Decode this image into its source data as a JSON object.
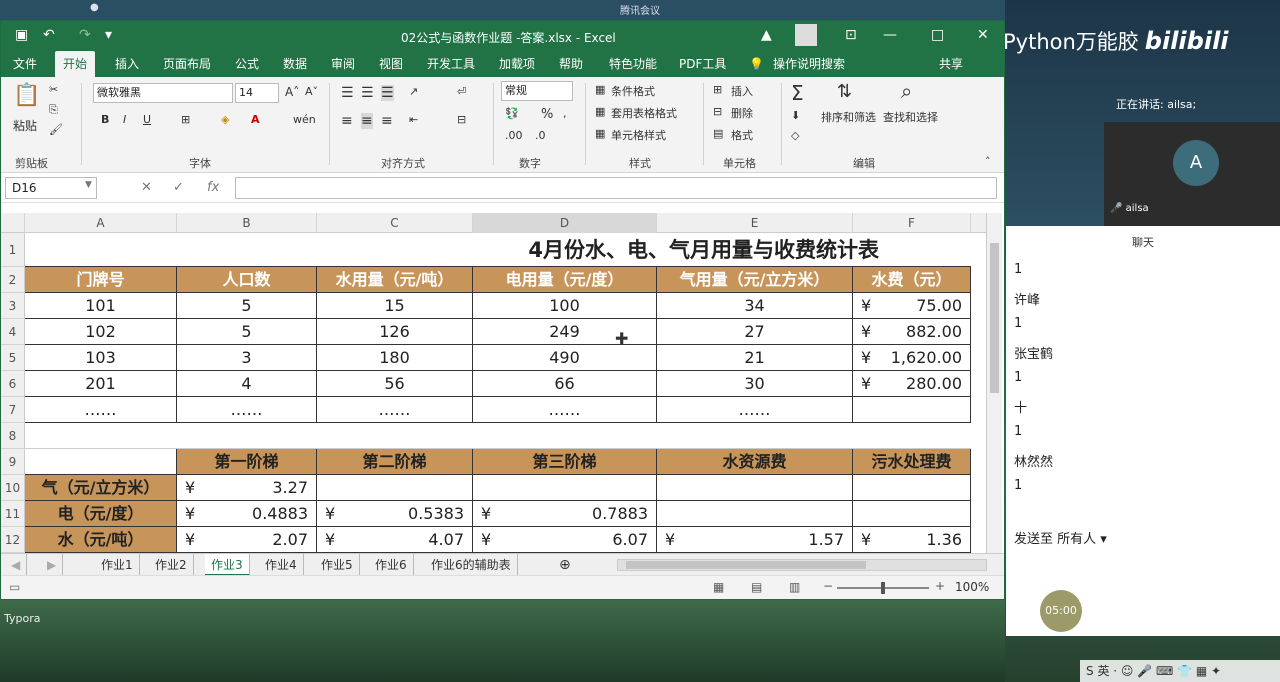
{
  "taskbar_top": {
    "left_text": "",
    "center_text": "腾讯会议"
  },
  "excel": {
    "title": "02公式与函数作业题 -答案.xlsx  -  Excel",
    "tabs": [
      "文件",
      "开始",
      "插入",
      "页面布局",
      "公式",
      "数据",
      "审阅",
      "视图",
      "开发工具",
      "加载项",
      "帮助",
      "特色功能",
      "PDF工具",
      "操作说明搜索",
      "共享"
    ],
    "active_tab": "开始",
    "ribbon": {
      "clipboard": {
        "paste": "粘贴",
        "label": "剪贴板"
      },
      "font": {
        "name": "微软雅黑",
        "size": "14",
        "bold": "B",
        "italic": "I",
        "underline": "U",
        "label": "字体"
      },
      "alignment": {
        "label": "对齐方式"
      },
      "number": {
        "format": "常规",
        "label": "数字",
        "percent": "%"
      },
      "styles": {
        "cond": "条件格式",
        "table": "套用表格格式",
        "cell": "单元格样式",
        "label": "样式"
      },
      "cells": {
        "insert": "插入",
        "delete": "删除",
        "format": "格式",
        "label": "单元格"
      },
      "editing": {
        "sort": "排序和筛选",
        "find": "查找和选择",
        "label": "编辑"
      }
    },
    "name_box": "D16",
    "formula_text": "",
    "columns": [
      "A",
      "B",
      "C",
      "D",
      "E",
      "F"
    ],
    "rows": [
      "1",
      "2",
      "3",
      "4",
      "5",
      "6",
      "7",
      "8",
      "9",
      "10",
      "11",
      "12"
    ],
    "sheet": {
      "title": "4月份水、电、气月用量与收费统计表",
      "headers": [
        "门牌号",
        "人口数",
        "水用量（元/吨）",
        "电用量（元/度）",
        "气用量（元/立方米）",
        "水费（元）"
      ],
      "data": [
        [
          "101",
          "5",
          "15",
          "100",
          "34",
          "75.00"
        ],
        [
          "102",
          "5",
          "126",
          "249",
          "27",
          "882.00"
        ],
        [
          "103",
          "3",
          "180",
          "490",
          "21",
          "1,620.00"
        ],
        [
          "201",
          "4",
          "56",
          "66",
          "30",
          "280.00"
        ],
        [
          "……",
          "……",
          "……",
          "……",
          "……",
          ""
        ]
      ],
      "yen": "¥",
      "tier_headers": [
        "第一阶梯",
        "第二阶梯",
        "第三阶梯",
        "水资源费",
        "污水处理费"
      ],
      "tiers": [
        {
          "label": "气（元/立方米）",
          "values": [
            "3.27",
            "",
            "",
            "",
            ""
          ]
        },
        {
          "label": "电（元/度）",
          "values": [
            "0.4883",
            "0.5383",
            "0.7883",
            "",
            ""
          ]
        },
        {
          "label": "水（元/吨）",
          "values": [
            "2.07",
            "4.07",
            "6.07",
            "1.57",
            "1.36"
          ]
        }
      ]
    },
    "sheet_tabs": [
      "作业1",
      "作业2",
      "作业3",
      "作业4",
      "作业5",
      "作业6",
      "作业6的辅助表"
    ],
    "active_sheet": "作业3",
    "zoom": "100%"
  },
  "right_panel": {
    "brand_text": "Python万能胶",
    "brand_logo": "bilibili",
    "speaking": "正在讲话: ailsa;",
    "video_avatar": "A",
    "video_name": "ailsa",
    "chat_title": "聊天",
    "messages": [
      "1",
      "许峰",
      "1",
      "张宝鹤",
      "1",
      "十",
      "1",
      "林然然",
      "1"
    ],
    "send_to": "发送至",
    "send_target": "所有人",
    "timer": "05:00"
  },
  "desktop": {
    "typora": "Typora",
    "tray_lang": "英"
  }
}
